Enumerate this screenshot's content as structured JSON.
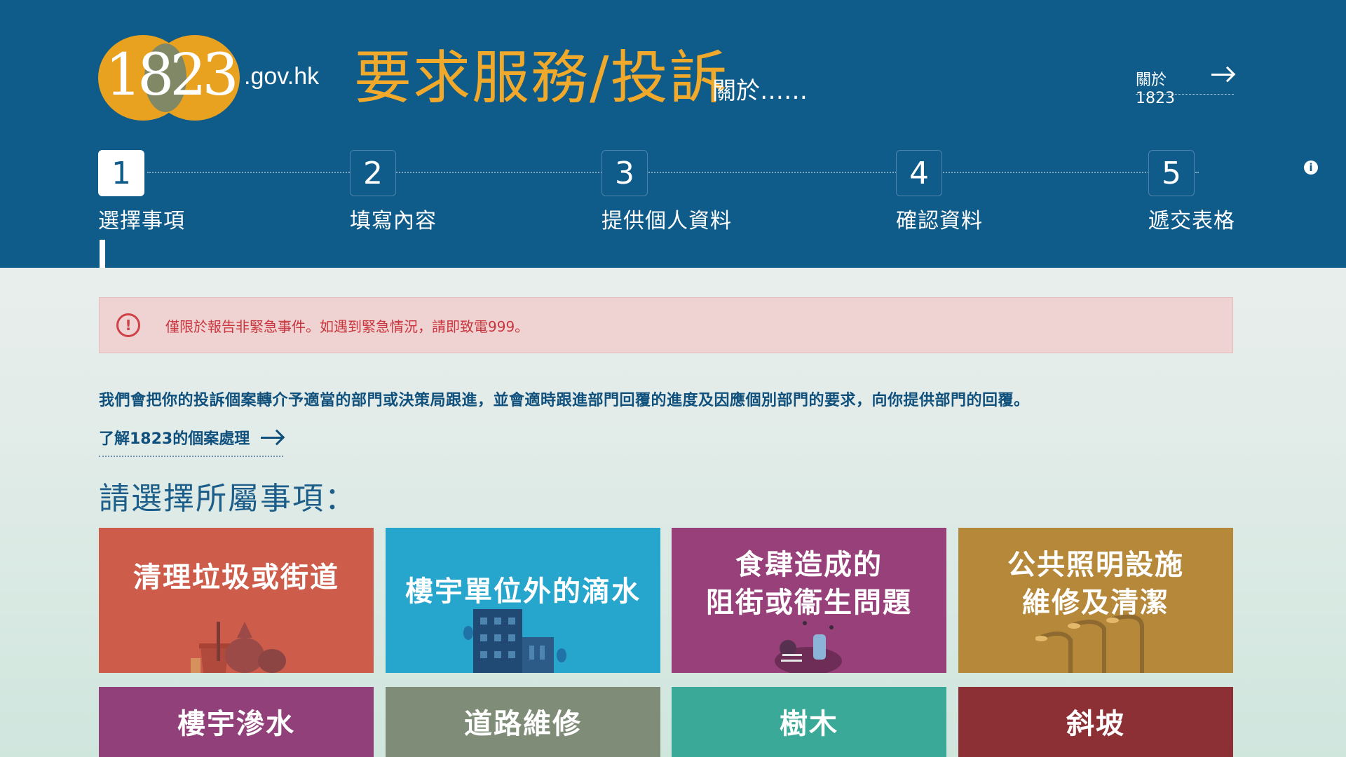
{
  "header": {
    "logo_number": "1823",
    "logo_suffix": ".gov.hk",
    "title": "要求服務/投訴",
    "title_sub": "關於……",
    "about_link": "關於1823"
  },
  "steps": [
    {
      "num": "1",
      "label": "選擇事項",
      "active": true
    },
    {
      "num": "2",
      "label": "填寫內容",
      "active": false
    },
    {
      "num": "3",
      "label": "提供個人資料",
      "active": false
    },
    {
      "num": "4",
      "label": "確認資料",
      "active": false
    },
    {
      "num": "5",
      "label": "遞交表格",
      "active": false
    }
  ],
  "notice": {
    "icon": "!",
    "text": "僅限於報告非緊急事件。如遇到緊急情況，請即致電999。"
  },
  "intro_text": "我們會把你的投訴個案轉介予適當的部門或決策局跟進，並會適時跟進部門回覆的進度及因應個別部門的要求，向你提供部門的回覆。",
  "learn_link": "了解1823的個案處理",
  "section_heading": "請選擇所屬事項：",
  "tiles": [
    {
      "label": "清理垃圾或街道",
      "color": "#cd5c4b"
    },
    {
      "label": "樓宇單位外的滴水",
      "color": "#27a6cd"
    },
    {
      "label": "食肆造成的\n阻街或衞生問題",
      "color": "#974079"
    },
    {
      "label": "公共照明設施\n維修及清潔",
      "color": "#b6883a"
    },
    {
      "label": "樓宇滲水",
      "color": "#924079"
    },
    {
      "label": "道路維修",
      "color": "#7f8c78"
    },
    {
      "label": "樹木",
      "color": "#3aa997"
    },
    {
      "label": "斜坡",
      "color": "#8c3036"
    }
  ],
  "info_icon": "i"
}
